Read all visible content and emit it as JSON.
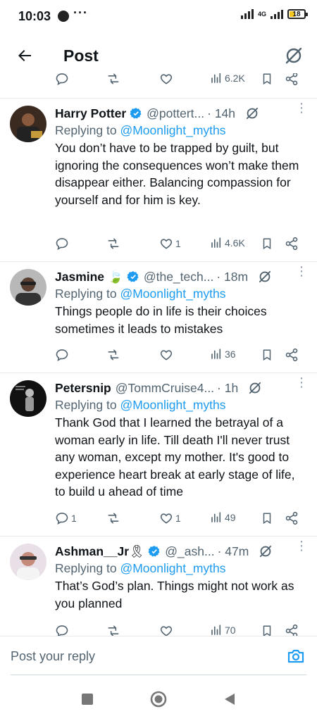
{
  "status": {
    "time": "10:03",
    "network": "4G",
    "battery": "18"
  },
  "header": {
    "title": "Post"
  },
  "prev": {
    "views": "6.2K"
  },
  "tweets": [
    {
      "name": "Harry Potter",
      "verified": true,
      "handle": "@pottert...",
      "time": "· 14h",
      "replying_label": "Replying to",
      "replying_to": "@Moonlight_myths",
      "text": "You don’t have to be trapped by guilt, but ignoring the consequences won’t make them disappear either. Balancing compassion for yourself and for him is key.",
      "replies": "",
      "reposts": "",
      "likes": "1",
      "views": "4.6K"
    },
    {
      "name": "Jasmine",
      "emoji": "🍃",
      "verified": true,
      "handle": "@the_tech...",
      "time": "· 18m",
      "replying_label": "Replying to",
      "replying_to": "@Moonlight_myths",
      "text": "Things people do in life is their choices sometimes it leads to mistakes",
      "replies": "",
      "reposts": "",
      "likes": "",
      "views": "36"
    },
    {
      "name": "Petersnip",
      "verified": false,
      "handle": "@TommCruise4...",
      "time": "· 1h",
      "replying_label": "Replying to",
      "replying_to": "@Moonlight_myths",
      "text": "Thank God that I learned the betrayal of a woman early in life. Till death I'll never trust any woman, except my mother. It's good to experience heart break at early stage of life, to build u ahead of time",
      "replies": "1",
      "reposts": "",
      "likes": "1",
      "views": "49"
    },
    {
      "name": "Ashman__Jr",
      "emoji": "🎗",
      "verified": true,
      "handle": "@_ash...",
      "time": "· 47m",
      "replying_label": "Replying to",
      "replying_to": "@Moonlight_myths",
      "text": "That’s God’s plan. Things might not work as you planned",
      "replies": "",
      "reposts": "",
      "likes": "",
      "views": "70"
    }
  ],
  "reply_bar": {
    "placeholder": "Post your reply"
  },
  "colors": {
    "accent": "#1d9bf0",
    "muted": "#536471",
    "text": "#0f1419",
    "divider": "#e7e9ea"
  },
  "icons": [
    "back-arrow-icon",
    "grok-icon",
    "verified-badge-icon",
    "reply-icon",
    "repost-icon",
    "like-icon",
    "views-icon",
    "bookmark-icon",
    "share-icon",
    "more-icon",
    "camera-icon",
    "nav-recents-icon",
    "nav-home-icon",
    "nav-back-icon"
  ]
}
